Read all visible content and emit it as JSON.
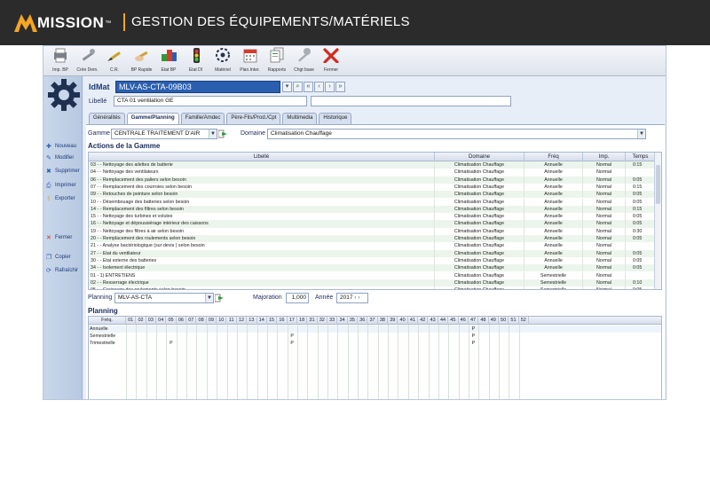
{
  "header": {
    "brand": "MISSION",
    "tm": "™",
    "title": "GESTION DES ÉQUIPEMENTS/MATÉRIELS"
  },
  "toolbar": [
    {
      "label": "Imp. BP",
      "icon": "printer-icon"
    },
    {
      "label": "Crée Dem.",
      "icon": "wrench-icon"
    },
    {
      "label": "C.R.",
      "icon": "pen-icon"
    },
    {
      "label": "BP Rapide",
      "icon": "hand-pen-icon"
    },
    {
      "label": "Etat BP",
      "icon": "cubes-icon"
    },
    {
      "label": "Etat DI",
      "icon": "traffic-light-icon"
    },
    {
      "label": "Matériel",
      "icon": "gear-outline-icon"
    },
    {
      "label": "Plan.Inter.",
      "icon": "calendar-icon"
    },
    {
      "label": "Rapports",
      "icon": "documents-icon"
    },
    {
      "label": "Chgt base",
      "icon": "key-icon"
    },
    {
      "label": "Fermer",
      "icon": "close-red-icon"
    }
  ],
  "sidebar": {
    "items": [
      {
        "label": "Nouveau",
        "icon": "new-icon"
      },
      {
        "label": "Modifier",
        "icon": "edit-icon"
      },
      {
        "label": "Supprimer",
        "icon": "delete-icon"
      },
      {
        "label": "Imprimer",
        "icon": "print-icon"
      },
      {
        "label": "Exporter",
        "icon": "export-icon"
      },
      {
        "label": "Fermer",
        "icon": "close-icon"
      },
      {
        "label": "Copier",
        "icon": "copy-icon"
      },
      {
        "label": "Rafraîchir",
        "icon": "refresh-icon"
      }
    ]
  },
  "form": {
    "idmat_label": "IdMat",
    "idmat_value": "MLV-AS-CTA-09B03",
    "libelle_label": "Libellé",
    "libelle_value": "CTA 01 ventilation GE",
    "libelle2_value": ""
  },
  "tabs": [
    {
      "label": "Généralités",
      "active": false
    },
    {
      "label": "Gamme/Planning",
      "active": true
    },
    {
      "label": "Famille/Amdec",
      "active": false
    },
    {
      "label": "Père-Fils/Prod./Cpt",
      "active": false
    },
    {
      "label": "Multimedia",
      "active": false
    },
    {
      "label": "Historique",
      "active": false
    }
  ],
  "gamme": {
    "label": "Gamme",
    "value": "CENTRALE TRAITEMENT D'AIR",
    "domaine_label": "Domaine",
    "domaine_value": "Climatisation Chauffage"
  },
  "actions": {
    "title": "Actions de la Gamme",
    "columns": [
      "Libellé",
      "Domaine",
      "Fréq",
      "Imp.",
      "Temps"
    ],
    "rows": [
      [
        "03 - - Nettoyage des ailettes de batterie",
        "Climatisation Chauffage",
        "Annuelle",
        "Normal",
        "0:15"
      ],
      [
        "04 - - Nettoyage des ventilateurs",
        "Climatisation Chauffage",
        "Annuelle",
        "Normal",
        ""
      ],
      [
        "06 - - Remplacement des paliers selon besoin",
        "Climatisation Chauffage",
        "Annuelle",
        "Normal",
        "0:05"
      ],
      [
        "07 - - Remplacement des courroies selon besoin",
        "Climatisation Chauffage",
        "Annuelle",
        "Normal",
        "0:15"
      ],
      [
        "09 - - Retouches de peinture selon besoin",
        "Climatisation Chauffage",
        "Annuelle",
        "Normal",
        "0:05"
      ],
      [
        "10 - - Désembouage des batteries selon besoin",
        "Climatisation Chauffage",
        "Annuelle",
        "Normal",
        "0:05"
      ],
      [
        "14 - - Remplacement des filtres selon besoin",
        "Climatisation Chauffage",
        "Annuelle",
        "Normal",
        "0:15"
      ],
      [
        "15 - - Nettoyage des turbines et volutes",
        "Climatisation Chauffage",
        "Annuelle",
        "Normal",
        "0:05"
      ],
      [
        "16 - - Nettoyage et dépoussiérage intérieur des caissons",
        "Climatisation Chauffage",
        "Annuelle",
        "Normal",
        "0:05"
      ],
      [
        "19 - - Nettoyage des filtres à air selon besoin",
        "Climatisation Chauffage",
        "Annuelle",
        "Normal",
        "0:30"
      ],
      [
        "20 - - Remplacement des roulements selon besoin",
        "Climatisation Chauffage",
        "Annuelle",
        "Normal",
        "0:05"
      ],
      [
        "21 - - Analyse bactériologique (sur devis ) selon besoin",
        "Climatisation Chauffage",
        "Annuelle",
        "Normal",
        ""
      ],
      [
        "27 - - Etat du ventilateur",
        "Climatisation Chauffage",
        "Annuelle",
        "Normal",
        "0:05"
      ],
      [
        "30 - - Etat externe des batteries",
        "Climatisation Chauffage",
        "Annuelle",
        "Normal",
        "0:05"
      ],
      [
        "34 - - Isolement électrique",
        "Climatisation Chauffage",
        "Annuelle",
        "Normal",
        "0:05"
      ],
      [
        "01 - 1) ENTRETIENS",
        "Climatisation Chauffage",
        "Semestrielle",
        "Normal",
        ""
      ],
      [
        "02 - - Resserrage électrique",
        "Climatisation Chauffage",
        "Semestrielle",
        "Normal",
        "0:10"
      ],
      [
        "05 - - Graissage des roulements selon besoin",
        "Climatisation Chauffage",
        "Semestrielle",
        "Normal",
        "0:05"
      ]
    ]
  },
  "planning_bar": {
    "label": "Planning",
    "value": "MLV-AS-CTA",
    "majoration_label": "Majoration",
    "majoration_value": "1,000",
    "annee_label": "Année",
    "annee_value": "2017"
  },
  "planning": {
    "title": "Planning",
    "freq_header": "Fréq.",
    "weeks": [
      "01",
      "02",
      "03",
      "04",
      "05",
      "06",
      "07",
      "08",
      "09",
      "10",
      "11",
      "12",
      "13",
      "14",
      "15",
      "16",
      "17",
      "18",
      "31",
      "32",
      "33",
      "34",
      "35",
      "36",
      "37",
      "38",
      "39",
      "40",
      "41",
      "42",
      "43",
      "44",
      "45",
      "46",
      "47",
      "48",
      "49",
      "50",
      "51",
      "52"
    ],
    "rows": [
      {
        "label": "Annuelle",
        "marks": [
          "47"
        ]
      },
      {
        "label": "Semestrielle",
        "marks": [
          "17",
          "47"
        ]
      },
      {
        "label": "Trimestrielle",
        "marks": [
          "05",
          "17",
          "47"
        ]
      }
    ],
    "mark": "P"
  }
}
